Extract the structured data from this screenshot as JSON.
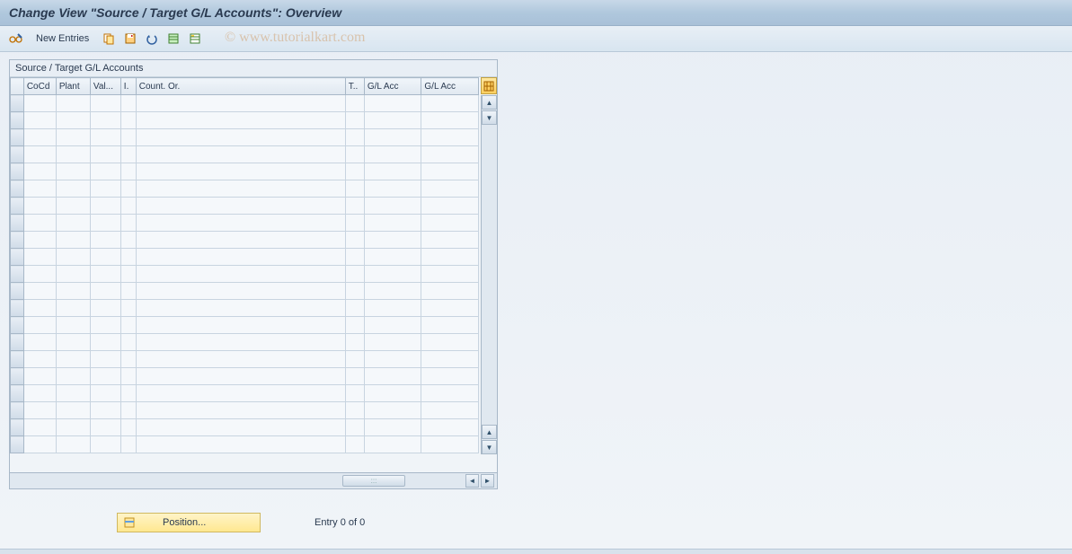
{
  "title": "Change View \"Source / Target G/L Accounts\": Overview",
  "toolbar": {
    "new_entries_label": "New Entries"
  },
  "watermark": "© www.tutorialkart.com",
  "panel": {
    "title": "Source / Target G/L Accounts",
    "columns": [
      "CoCd",
      "Plant",
      "Val...",
      "I.",
      "Count. Or.",
      "T..",
      "G/L Acc",
      "G/L Acc"
    ],
    "rows": [
      [
        "",
        "",
        "",
        "",
        "",
        "",
        "",
        ""
      ],
      [
        "",
        "",
        "",
        "",
        "",
        "",
        "",
        ""
      ],
      [
        "",
        "",
        "",
        "",
        "",
        "",
        "",
        ""
      ],
      [
        "",
        "",
        "",
        "",
        "",
        "",
        "",
        ""
      ],
      [
        "",
        "",
        "",
        "",
        "",
        "",
        "",
        ""
      ],
      [
        "",
        "",
        "",
        "",
        "",
        "",
        "",
        ""
      ],
      [
        "",
        "",
        "",
        "",
        "",
        "",
        "",
        ""
      ],
      [
        "",
        "",
        "",
        "",
        "",
        "",
        "",
        ""
      ],
      [
        "",
        "",
        "",
        "",
        "",
        "",
        "",
        ""
      ],
      [
        "",
        "",
        "",
        "",
        "",
        "",
        "",
        ""
      ],
      [
        "",
        "",
        "",
        "",
        "",
        "",
        "",
        ""
      ],
      [
        "",
        "",
        "",
        "",
        "",
        "",
        "",
        ""
      ],
      [
        "",
        "",
        "",
        "",
        "",
        "",
        "",
        ""
      ],
      [
        "",
        "",
        "",
        "",
        "",
        "",
        "",
        ""
      ],
      [
        "",
        "",
        "",
        "",
        "",
        "",
        "",
        ""
      ],
      [
        "",
        "",
        "",
        "",
        "",
        "",
        "",
        ""
      ],
      [
        "",
        "",
        "",
        "",
        "",
        "",
        "",
        ""
      ],
      [
        "",
        "",
        "",
        "",
        "",
        "",
        "",
        ""
      ],
      [
        "",
        "",
        "",
        "",
        "",
        "",
        "",
        ""
      ],
      [
        "",
        "",
        "",
        "",
        "",
        "",
        "",
        ""
      ],
      [
        "",
        "",
        "",
        "",
        "",
        "",
        "",
        ""
      ]
    ]
  },
  "footer": {
    "position_label": "Position...",
    "entry_text": "Entry 0 of 0"
  },
  "icons": {
    "glasses": "glasses-pencil-icon",
    "copy": "copy-icon",
    "save": "save-icon",
    "undo": "undo-icon",
    "select_all": "select-all-icon",
    "deselect": "deselect-icon",
    "table": "table-config-icon"
  }
}
